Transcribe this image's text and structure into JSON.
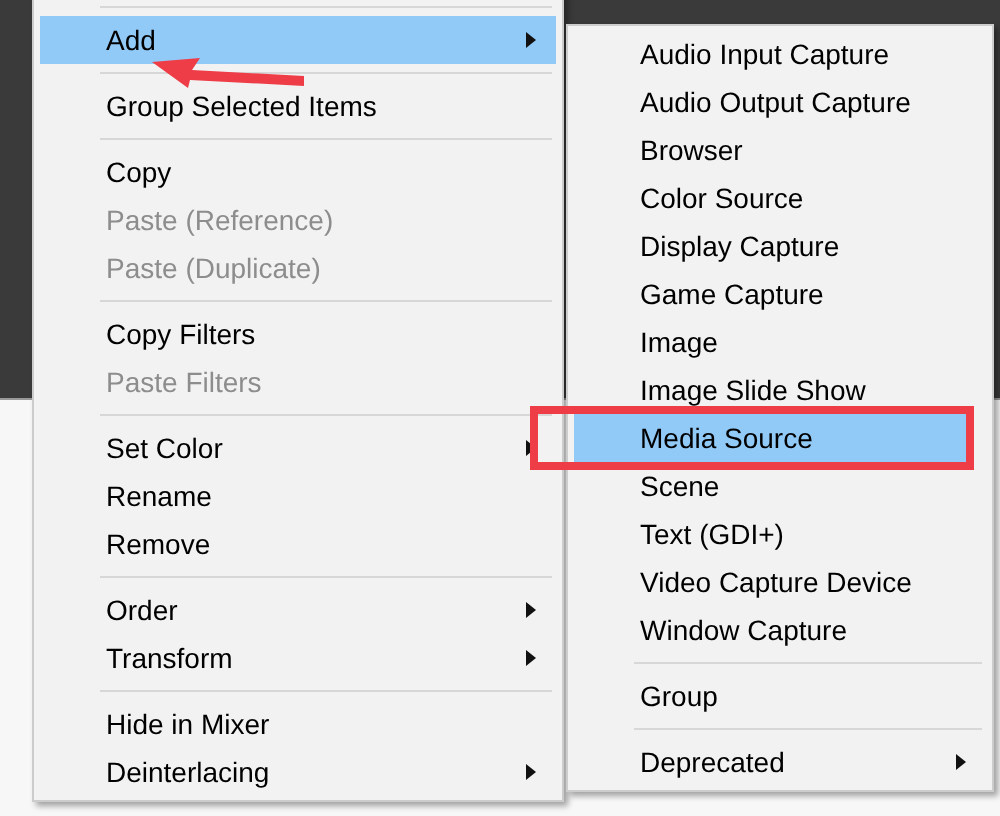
{
  "context_menu": {
    "sections": [
      [
        {
          "label": "Add",
          "selected": true,
          "disabled": false,
          "submenu": true
        }
      ],
      [
        {
          "label": "Group Selected Items",
          "selected": false,
          "disabled": false,
          "submenu": false
        }
      ],
      [
        {
          "label": "Copy",
          "selected": false,
          "disabled": false,
          "submenu": false
        },
        {
          "label": "Paste (Reference)",
          "selected": false,
          "disabled": true,
          "submenu": false
        },
        {
          "label": "Paste (Duplicate)",
          "selected": false,
          "disabled": true,
          "submenu": false
        }
      ],
      [
        {
          "label": "Copy Filters",
          "selected": false,
          "disabled": false,
          "submenu": false
        },
        {
          "label": "Paste Filters",
          "selected": false,
          "disabled": true,
          "submenu": false
        }
      ],
      [
        {
          "label": "Set Color",
          "selected": false,
          "disabled": false,
          "submenu": true
        },
        {
          "label": "Rename",
          "selected": false,
          "disabled": false,
          "submenu": false
        },
        {
          "label": "Remove",
          "selected": false,
          "disabled": false,
          "submenu": false
        }
      ],
      [
        {
          "label": "Order",
          "selected": false,
          "disabled": false,
          "submenu": true
        },
        {
          "label": "Transform",
          "selected": false,
          "disabled": false,
          "submenu": true
        }
      ],
      [
        {
          "label": "Hide in Mixer",
          "selected": false,
          "disabled": false,
          "submenu": false
        },
        {
          "label": "Deinterlacing",
          "selected": false,
          "disabled": false,
          "submenu": true
        }
      ]
    ]
  },
  "add_submenu": {
    "sections": [
      [
        {
          "label": "Audio Input Capture",
          "selected": false,
          "submenu": false,
          "marked": false
        },
        {
          "label": "Audio Output Capture",
          "selected": false,
          "submenu": false,
          "marked": false
        },
        {
          "label": "Browser",
          "selected": false,
          "submenu": false,
          "marked": false
        },
        {
          "label": "Color Source",
          "selected": false,
          "submenu": false,
          "marked": false
        },
        {
          "label": "Display Capture",
          "selected": false,
          "submenu": false,
          "marked": false
        },
        {
          "label": "Game Capture",
          "selected": false,
          "submenu": false,
          "marked": false
        },
        {
          "label": "Image",
          "selected": false,
          "submenu": false,
          "marked": false
        },
        {
          "label": "Image Slide Show",
          "selected": false,
          "submenu": false,
          "marked": false
        },
        {
          "label": "Media Source",
          "selected": true,
          "submenu": false,
          "marked": true
        },
        {
          "label": "Scene",
          "selected": false,
          "submenu": false,
          "marked": false
        },
        {
          "label": "Text (GDI+)",
          "selected": false,
          "submenu": false,
          "marked": false
        },
        {
          "label": "Video Capture Device",
          "selected": false,
          "submenu": false,
          "marked": false
        },
        {
          "label": "Window Capture",
          "selected": false,
          "submenu": false,
          "marked": false
        }
      ],
      [
        {
          "label": "Group",
          "selected": false,
          "submenu": false,
          "marked": false
        }
      ],
      [
        {
          "label": "Deprecated",
          "selected": false,
          "submenu": true,
          "marked": false
        }
      ]
    ]
  },
  "annotations": {
    "pointer_arrow": true
  }
}
